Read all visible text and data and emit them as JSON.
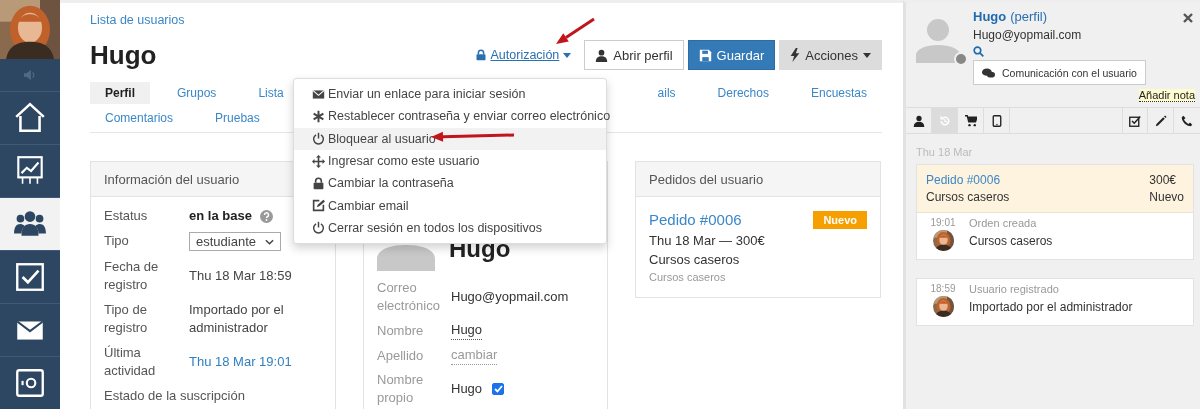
{
  "sidebar": {
    "items": [
      {
        "selected": false
      },
      {
        "selected": false
      },
      {
        "selected": true
      },
      {
        "selected": false
      },
      {
        "selected": false
      },
      {
        "selected": false
      }
    ]
  },
  "breadcrumb": "Lista de usuarios",
  "title": "Hugo",
  "actions": {
    "authorization": "Autorización",
    "buttons": [
      {
        "label": "Abrir perfil",
        "kind": "outline"
      },
      {
        "label": "Guardar",
        "kind": "primary"
      },
      {
        "label": "Acciones",
        "kind": "dropdown"
      }
    ]
  },
  "tabs": {
    "rows": [
      [
        {
          "label": "Perfil",
          "selected": true
        },
        {
          "label": "Grupos",
          "selected": false
        },
        {
          "label": "Lista",
          "selected": false
        },
        {
          "label": "ails",
          "selected": false
        },
        {
          "label": "Derechos",
          "selected": false
        },
        {
          "label": "Encuestas",
          "selected": false
        }
      ],
      [
        {
          "label": "Comentarios",
          "selected": false
        },
        {
          "label": "Pruebas",
          "selected": false
        }
      ]
    ]
  },
  "menu": {
    "items": [
      {
        "label": "Enviar un enlace para iniciar sesión",
        "highlighted": false
      },
      {
        "label": "Restablecer contraseña y enviar correo electrónico",
        "highlighted": false
      },
      {
        "label": "Bloquear al usuario",
        "highlighted": true
      },
      {
        "label": "Ingresar como este usuario",
        "highlighted": false
      },
      {
        "label": "Cambiar la contraseña",
        "highlighted": false
      },
      {
        "label": "Cambiar email",
        "highlighted": false
      },
      {
        "label": "Cerrar sesión en todos los dispositivos",
        "highlighted": false
      }
    ]
  },
  "user_info": {
    "title": "Información del usuario",
    "rows": [
      {
        "kind": "status",
        "label": "Estatus",
        "value": "en la base"
      },
      {
        "kind": "select",
        "label": "Tipo",
        "value": "estudiante"
      },
      {
        "kind": "text",
        "label": "Fecha de registro",
        "value": "Thu 18 Mar 18:59"
      },
      {
        "kind": "text",
        "label": "Tipo de registro",
        "value": "Importado por el administrador"
      },
      {
        "kind": "link",
        "label": "Última actividad",
        "value": "Thu 18 Mar 19:01"
      },
      {
        "kind": "heading",
        "label": "Estado de la suscripción"
      }
    ]
  },
  "profile_card": {
    "name": "Hugo",
    "rows": [
      {
        "kind": "text",
        "label": "Correo electrónico",
        "value": "Hugo@yopmail.com"
      },
      {
        "kind": "editable",
        "label": "Nombre",
        "value": "Hugo"
      },
      {
        "kind": "empty",
        "label": "Apellido",
        "value": "cambiar"
      },
      {
        "kind": "checkbox",
        "label": "Nombre propio",
        "value": "Hugo",
        "checked": true
      }
    ]
  },
  "orders_card": {
    "title": "Pedidos del usuario",
    "orders": [
      {
        "number": "Pedido #0006",
        "badge": "Nuevo",
        "summary": "Thu 18 Mar — 300€",
        "product": "Cursos caseros",
        "note": "Cursos caseros"
      }
    ]
  },
  "side_panel": {
    "name": "Hugo",
    "profile_link": "(perfil)",
    "email": "Hugo@yopmail.com",
    "contact_button": "Comunicación con el usuario",
    "note_link": "Añadir nota",
    "tabs": [
      {
        "selected": false
      },
      {
        "selected": true
      },
      {
        "selected": false
      },
      {
        "selected": false
      },
      {
        "selected": false
      },
      {
        "selected": false
      },
      {
        "selected": false
      }
    ],
    "date": "Thu 18 Mar",
    "events": [
      {
        "order": {
          "number": "Pedido #0006",
          "amount": "300€",
          "product": "Cursos caseros",
          "status": "Nuevo"
        },
        "time": "19:01",
        "title": "Orden creada",
        "detail": "Cursos caseros"
      },
      {
        "time": "18:59",
        "title": "Usuario registrado",
        "detail": "Importado por el administrador"
      }
    ]
  }
}
